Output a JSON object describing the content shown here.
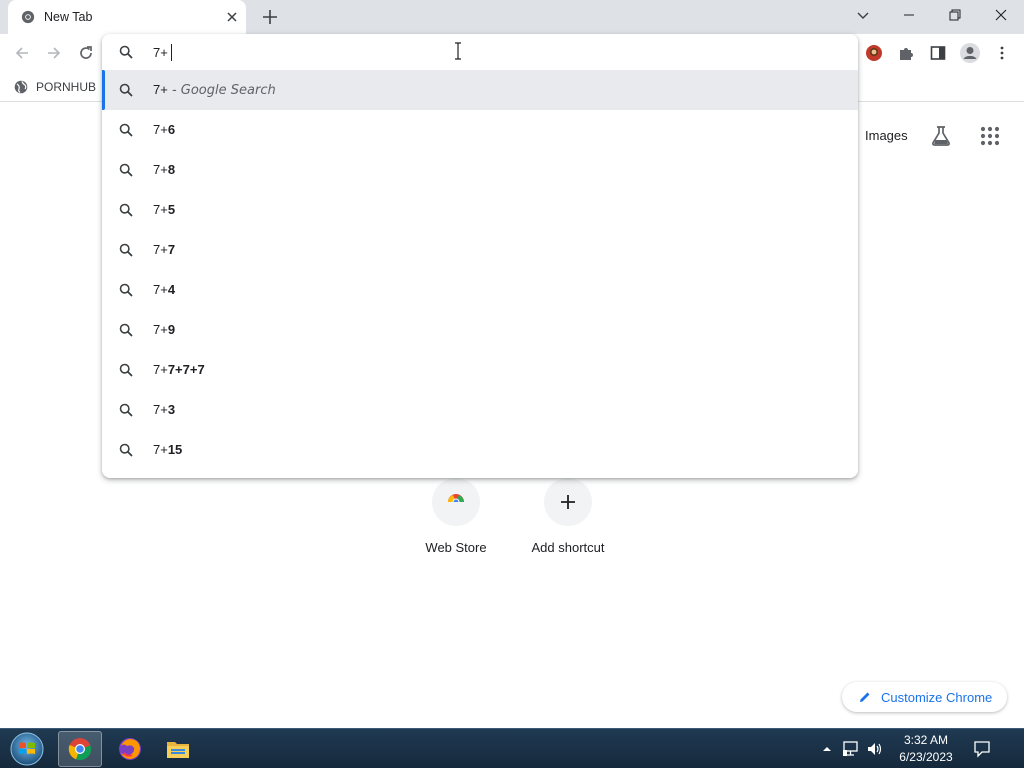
{
  "browser": {
    "tab": {
      "title": "New Tab",
      "icon": "chrome-icon"
    },
    "window_controls": [
      "tab-search",
      "minimize",
      "maximize",
      "close"
    ]
  },
  "bookmarks": [
    {
      "label": "PORNHUB",
      "icon": "globe-icon"
    }
  ],
  "omnibox": {
    "value": "7+",
    "suggestions": [
      {
        "typed": "7+",
        "rest": "",
        "suffix": " - Google Search",
        "selected": true
      },
      {
        "typed": "7+",
        "rest": "6"
      },
      {
        "typed": "7+",
        "rest": "8"
      },
      {
        "typed": "7+",
        "rest": "5"
      },
      {
        "typed": "7+",
        "rest": "7"
      },
      {
        "typed": "7+",
        "rest": "4"
      },
      {
        "typed": "7+",
        "rest": "9"
      },
      {
        "typed": "7+",
        "rest": "7+7+7"
      },
      {
        "typed": "7+",
        "rest": "3"
      },
      {
        "typed": "7+",
        "rest": "15"
      }
    ]
  },
  "ntp": {
    "images_link": "Images",
    "shortcuts": [
      {
        "label": "Web Store",
        "icon": "web-store-icon"
      },
      {
        "label": "Add shortcut",
        "icon": "plus-icon"
      }
    ],
    "customize_label": "Customize Chrome"
  },
  "taskbar": {
    "apps": [
      "chrome",
      "firefox",
      "file-explorer"
    ],
    "clock": {
      "time": "3:32 AM",
      "date": "6/23/2023"
    }
  },
  "colors": {
    "accent": "#1a73e8",
    "tabstrip": "#dee1e6",
    "selected_suggestion": "#e8eaed",
    "taskbar": "#1f3a52"
  }
}
